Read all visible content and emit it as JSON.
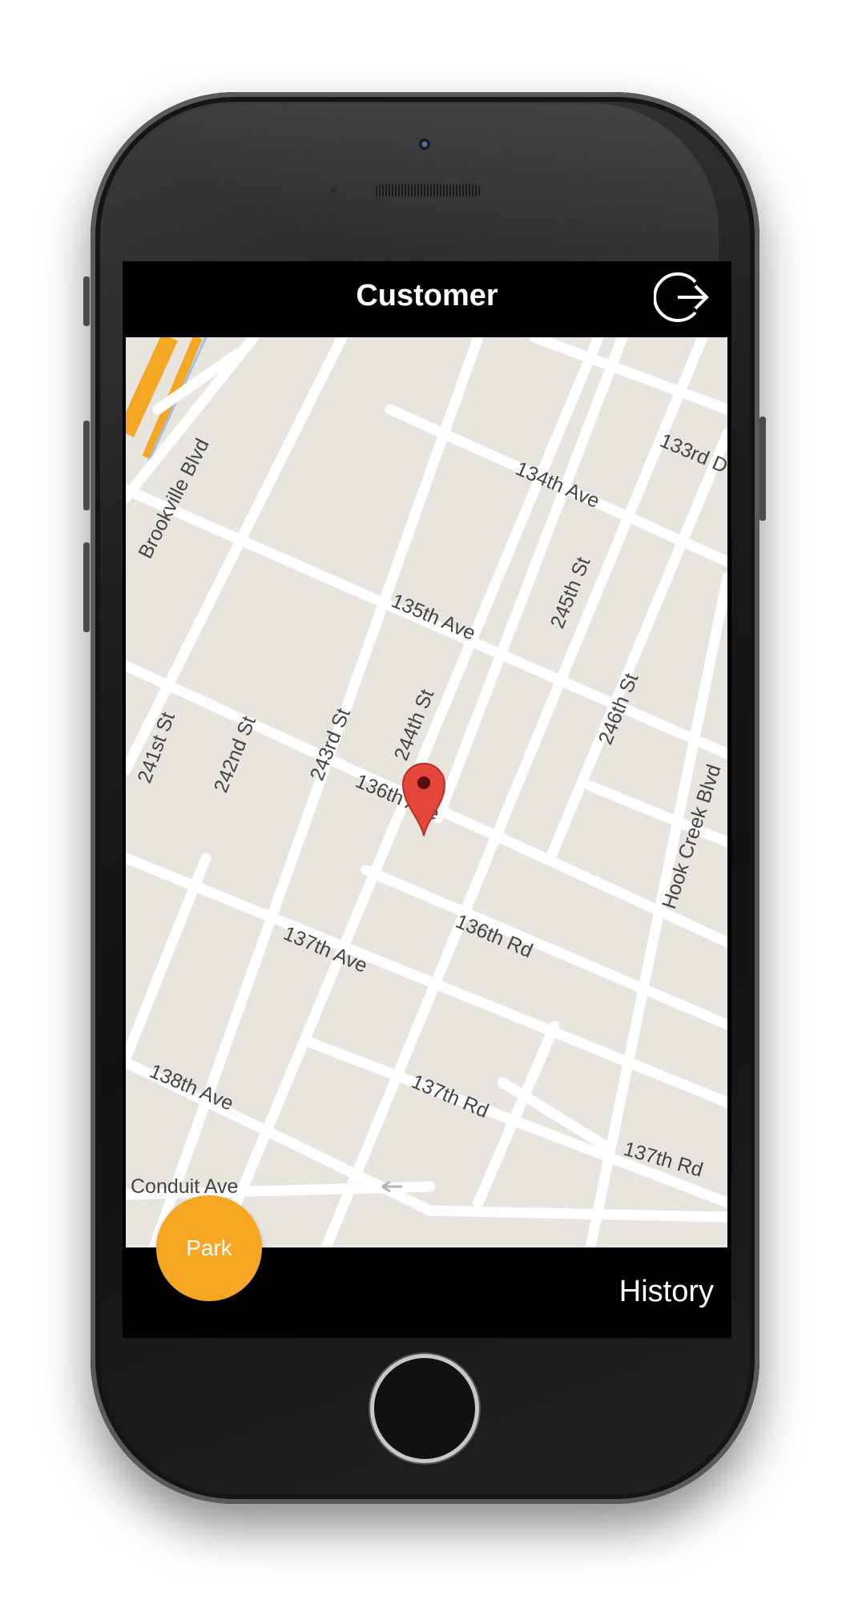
{
  "app": {
    "title": "Customer",
    "logout_icon": "logout-arrow-icon"
  },
  "map": {
    "street_labels": {
      "brookville": "Brookville Blvd",
      "ave133rd": "133rd D",
      "ave134": "134th Ave",
      "ave135": "135th Ave",
      "ave136": "136th Ave",
      "rd136": "136th Rd",
      "ave137": "137th Ave",
      "rd137a": "137th Rd",
      "rd137b": "137th Rd",
      "ave138": "138th Ave",
      "conduit": "Conduit Ave",
      "st241": "241st St",
      "st242": "242nd St",
      "st243": "243rd St",
      "st244": "244th St",
      "st245": "245th St",
      "st246": "246th St",
      "hookcreek": "Hook Creek Blvd"
    },
    "marker_icon": "location-pin-icon"
  },
  "actions": {
    "park_label": "Park",
    "history_label": "History"
  },
  "colors": {
    "accent": "#f5a623",
    "marker": "#e5463c",
    "map_bg": "#e8e4de",
    "road": "#ffffff",
    "highway": "#f5a623"
  }
}
